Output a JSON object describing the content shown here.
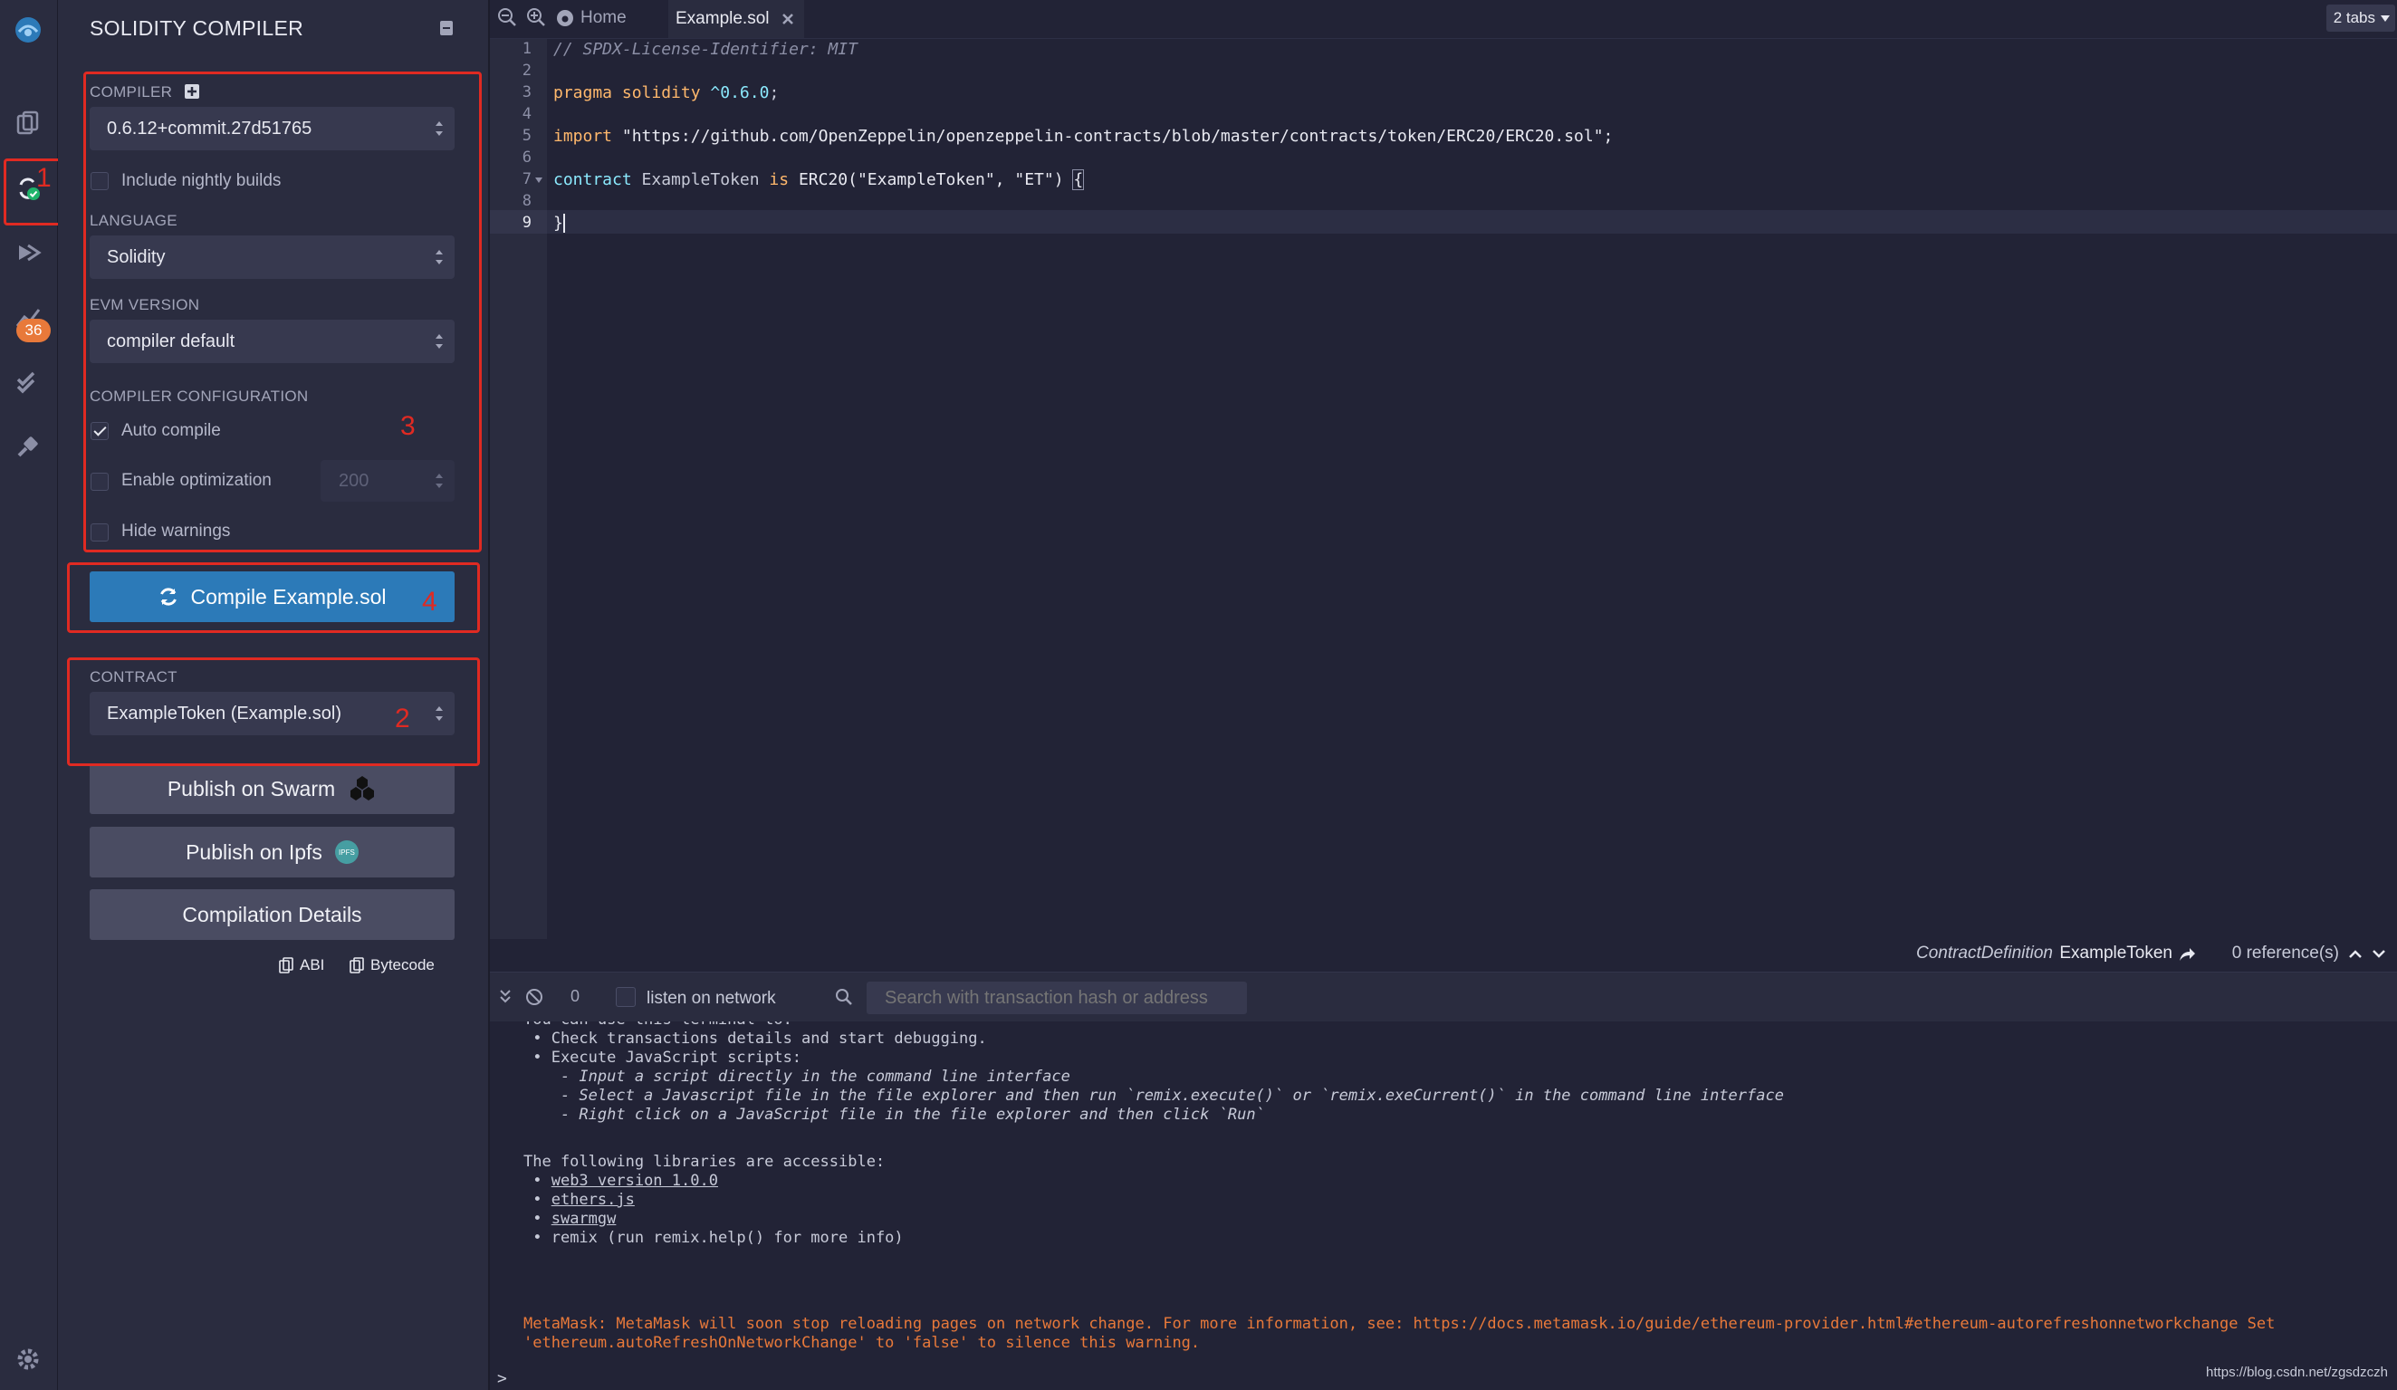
{
  "panel": {
    "title": "SOLIDITY COMPILER",
    "compiler_label": "COMPILER",
    "compiler_value": "0.6.12+commit.27d51765",
    "nightly_label": "Include nightly builds",
    "language_label": "LANGUAGE",
    "language_value": "Solidity",
    "evm_label": "EVM VERSION",
    "evm_value": "compiler default",
    "config_label": "COMPILER CONFIGURATION",
    "auto_compile_label": "Auto compile",
    "optimization_label": "Enable optimization",
    "optimization_runs": "200",
    "hide_warnings_label": "Hide warnings",
    "compile_button": "Compile Example.sol",
    "contract_label": "CONTRACT",
    "contract_value": "ExampleToken (Example.sol)",
    "publish_swarm": "Publish on Swarm",
    "publish_ipfs": "Publish on Ipfs",
    "ipfs_badge": "IPFS",
    "compilation_details": "Compilation Details",
    "abi_label": "ABI",
    "bytecode_label": "Bytecode"
  },
  "annotations": {
    "n1": "1",
    "n2": "2",
    "n3": "3",
    "n4": "4"
  },
  "iconbar": {
    "badge_count": "36"
  },
  "tabs": {
    "home": "Home",
    "file": "Example.sol",
    "tabs_count": "2 tabs"
  },
  "editor": {
    "line_numbers": [
      "1",
      "2",
      "3",
      "4",
      "5",
      "6",
      "7",
      "8",
      "9"
    ],
    "l1": "// SPDX-License-Identifier: MIT",
    "l3_kw": "pragma solidity",
    "l3_ver": "^0.6.0",
    "l3_end": ";",
    "l5_kw": "import",
    "l5_str": " \"https://github.com/OpenZeppelin/openzeppelin-contracts/blob/master/contracts/token/ERC20/ERC20.sol\";",
    "l7_kw": "contract",
    "l7_name": " ExampleToken ",
    "l7_is": "is",
    "l7_rest": " ERC20(\"ExampleToken\", \"ET\") ",
    "l7_brace": "{",
    "l9": "}"
  },
  "status": {
    "def_kind": "ContractDefinition",
    "def_name": "ExampleToken",
    "references": "0 reference(s)"
  },
  "terminal": {
    "tx_count": "0",
    "listen_label": "listen on network",
    "search_placeholder": "Search with transaction hash or address",
    "cut_line": "You can use this terminal to:",
    "lines": [
      " • Check transactions details and start debugging.",
      " • Execute JavaScript scripts:",
      "    - Input a script directly in the command line interface",
      "    - Select a Javascript file in the file explorer and then run `remix.execute()` or `remix.exeCurrent()` in the command line interface",
      "    - Right click on a JavaScript file in the file explorer and then click `Run`"
    ],
    "libs_title": "The following libraries are accessible:",
    "lib1": "web3 version 1.0.0",
    "lib2": "ethers.js",
    "lib3": "swarmgw",
    "lib4": " remix (run remix.help() for more info)",
    "warn1": "MetaMask: MetaMask will soon stop reloading pages on network change. For more information, see: https://docs.metamask.io/guide/ethereum-provider.html#ethereum-autorefreshonnetworkchange Set",
    "warn2": "'ethereum.autoRefreshOnNetworkChange' to 'false' to silence this warning.",
    "prompt": ">",
    "watermark": "https://blog.csdn.net/zgsdzczh"
  },
  "colors": {
    "accent": "#2c7ab8",
    "annotation": "#e02a22",
    "success": "#1fb36b",
    "badge": "#e8793a"
  }
}
